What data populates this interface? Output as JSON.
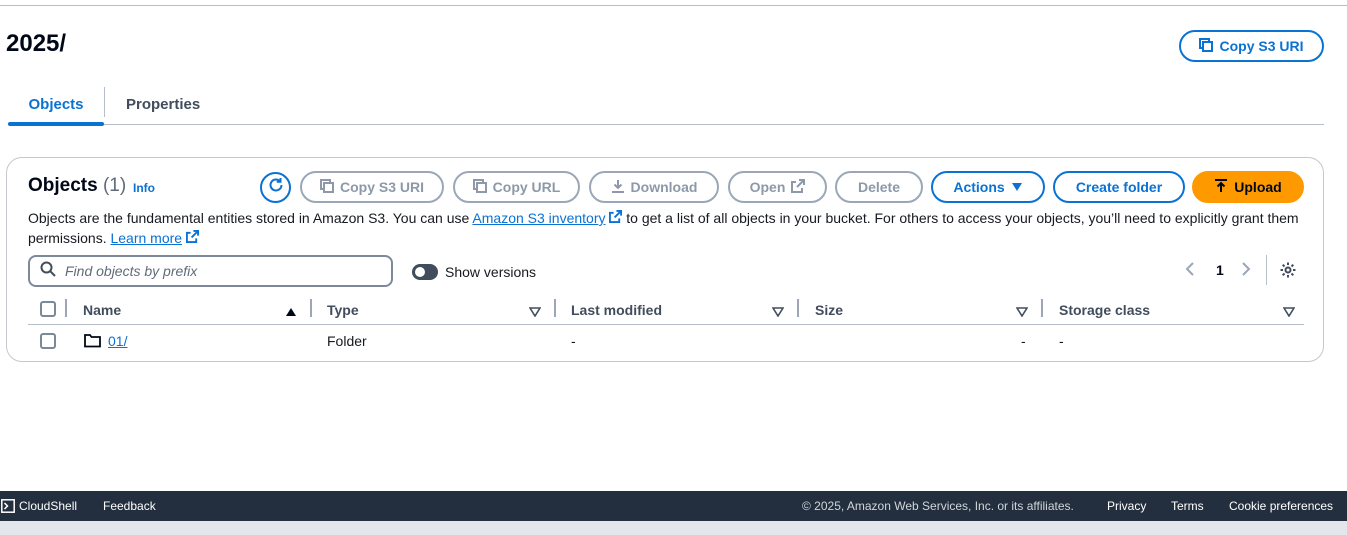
{
  "page": {
    "title": "2025/",
    "copy_s3_uri": "Copy S3 URI"
  },
  "tabs": [
    {
      "label": "Objects",
      "active": true
    },
    {
      "label": "Properties",
      "active": false
    }
  ],
  "objects_panel": {
    "title": "Objects",
    "count": "(1)",
    "info": "Info",
    "buttons": {
      "copy_s3_uri": "Copy S3 URI",
      "copy_url": "Copy URL",
      "download": "Download",
      "open": "Open",
      "delete": "Delete",
      "actions": "Actions",
      "create_folder": "Create folder",
      "upload": "Upload"
    },
    "description": {
      "part1": "Objects are the fundamental entities stored in Amazon S3. You can use ",
      "link1": "Amazon S3 inventory",
      "part2": " to get a list of all objects in your bucket. For others to access your objects, you’ll need to explicitly grant them permissions. ",
      "link2": "Learn more"
    },
    "search": {
      "placeholder": "Find objects by prefix",
      "value": ""
    },
    "show_versions": {
      "label": "Show versions",
      "enabled": false
    },
    "pagination": {
      "current_page": "1"
    },
    "table": {
      "columns": [
        "Name",
        "Type",
        "Last modified",
        "Size",
        "Storage class"
      ],
      "rows": [
        {
          "name": "01/",
          "type": "Folder",
          "last_modified": "-",
          "size": "-",
          "storage_class": "-"
        }
      ]
    }
  },
  "footer": {
    "cloudshell": "CloudShell",
    "feedback": "Feedback",
    "copyright": "© 2025, Amazon Web Services, Inc. or its affiliates.",
    "privacy": "Privacy",
    "terms": "Terms",
    "cookie_preferences": "Cookie preferences"
  },
  "colors": {
    "accent": "#0972d3",
    "primary_button": "#ff9900",
    "footer_bg": "#232f3e",
    "disabled": "#8d99a8"
  }
}
